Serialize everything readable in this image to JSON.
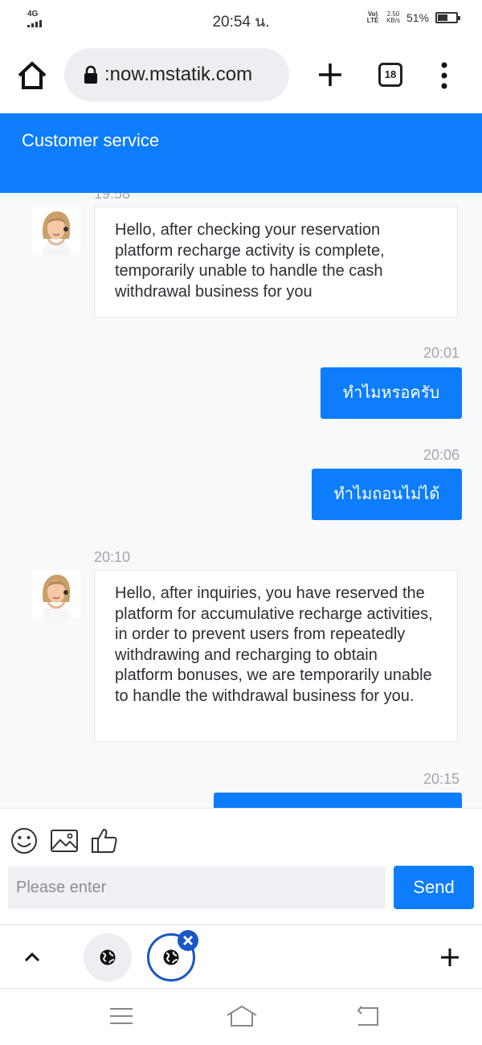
{
  "status_bar": {
    "network": "4G",
    "time": "20:54 น.",
    "volte": "Vo) LTE",
    "speed_value": "2.50",
    "speed_unit": "KB/s",
    "battery": "51%",
    "battery_level": 0.51
  },
  "browser": {
    "url": ":now.mstatik.com",
    "tab_count": "18",
    "icons": [
      "home-icon",
      "lock-icon",
      "plus-icon",
      "tabs-icon",
      "more-icon"
    ]
  },
  "header": {
    "title": "Customer service"
  },
  "chat": {
    "cut_timestamp": "19:58",
    "messages": [
      {
        "side": "agent",
        "time": "",
        "text": "Hello, after checking your reservation platform recharge activity is complete, temporarily unable to handle the cash withdrawal business for you"
      },
      {
        "side": "user",
        "time": "20:01",
        "text": "ทำไมหรอครับ"
      },
      {
        "side": "user",
        "time": "20:06",
        "text": "ทำไมถอนไม่ได้"
      },
      {
        "side": "agent",
        "time": "20:10",
        "text": "Hello, after inquiries, you have reserved the platform for accumulative recharge activities, in order to prevent users from repeatedly withdrawing and recharging to obtain platform bonuses, we are temporarily unable to handle the withdrawal business for you."
      },
      {
        "side": "user",
        "time": "20:15",
        "text": ""
      }
    ]
  },
  "composer": {
    "placeholder": "Please enter",
    "value": "",
    "send_label": "Send",
    "tools": [
      "emoji-icon",
      "image-icon",
      "thumbs-up-icon"
    ]
  },
  "bottom_bar": {
    "icons": [
      "chevron-up-icon",
      "globe-icon",
      "globe-icon",
      "close-icon",
      "plus-icon"
    ]
  },
  "system_nav": {
    "icons": [
      "menu-icon",
      "home-outline-icon",
      "back-icon"
    ]
  },
  "colors": {
    "accent": "#0d7dfc",
    "chat_bg": "#f8f9fb",
    "timestamp": "#a3a6ad",
    "active_tab_ring": "#1a56c4"
  }
}
